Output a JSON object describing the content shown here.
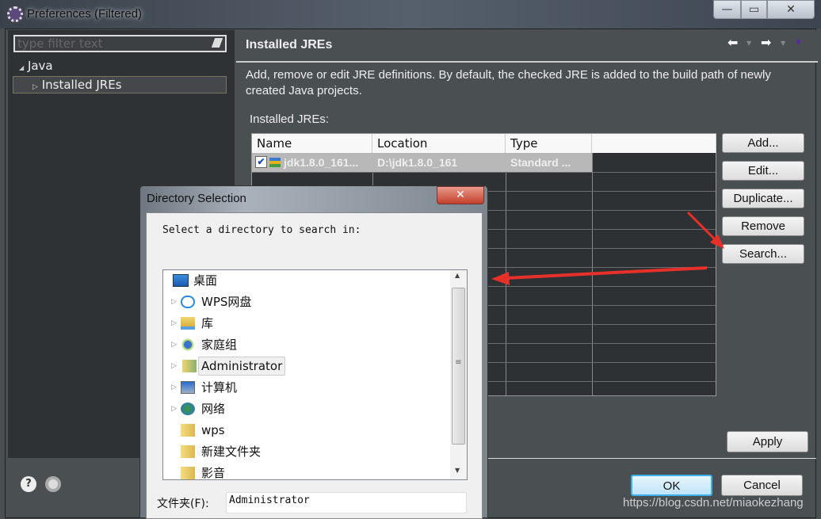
{
  "window": {
    "title": "Preferences (Filtered)",
    "minimize": "—",
    "maximize": "▭",
    "close": "✕"
  },
  "left": {
    "filter_placeholder": "type filter text",
    "tree": [
      {
        "label": "Java",
        "expanded": true
      },
      {
        "label": "Installed JREs",
        "selected": true
      }
    ]
  },
  "right": {
    "title": "Installed JREs",
    "description": "Add, remove or edit JRE definitions. By default, the checked JRE is added to the build path of newly created Java projects.",
    "table_label": "Installed JREs:",
    "columns": [
      "Name",
      "Location",
      "Type"
    ],
    "rows": [
      {
        "checked": true,
        "name": "jdk1.8.0_161...",
        "location": "D:\\jdk1.8.0_161",
        "type": "Standard ..."
      }
    ],
    "buttons": {
      "add": "Add...",
      "edit": "Edit...",
      "duplicate": "Duplicate...",
      "remove": "Remove",
      "search": "Search..."
    },
    "apply": "Apply"
  },
  "footer": {
    "ok": "OK",
    "cancel": "Cancel"
  },
  "dialog": {
    "title": "Directory Selection",
    "close": "✕",
    "prompt": "Select a directory to search in:",
    "items": [
      {
        "label": "桌面",
        "icon": "desktop-icon"
      },
      {
        "label": "WPS网盘",
        "icon": "cloud-icon"
      },
      {
        "label": "库",
        "icon": "library-icon"
      },
      {
        "label": "家庭组",
        "icon": "homegroup-icon"
      },
      {
        "label": "Administrator",
        "icon": "user-folder-icon",
        "selected": true
      },
      {
        "label": "计算机",
        "icon": "computer-icon"
      },
      {
        "label": "网络",
        "icon": "network-icon"
      },
      {
        "label": "wps",
        "icon": "folder-icon"
      },
      {
        "label": "新建文件夹",
        "icon": "folder-icon"
      },
      {
        "label": "影音",
        "icon": "folder-icon"
      }
    ],
    "folder_label": "文件夹(F):",
    "folder_value": "Administrator"
  },
  "watermark": "https://blog.csdn.net/miaokezhang",
  "colors": {
    "annotation_arrow": "#e8302a"
  }
}
